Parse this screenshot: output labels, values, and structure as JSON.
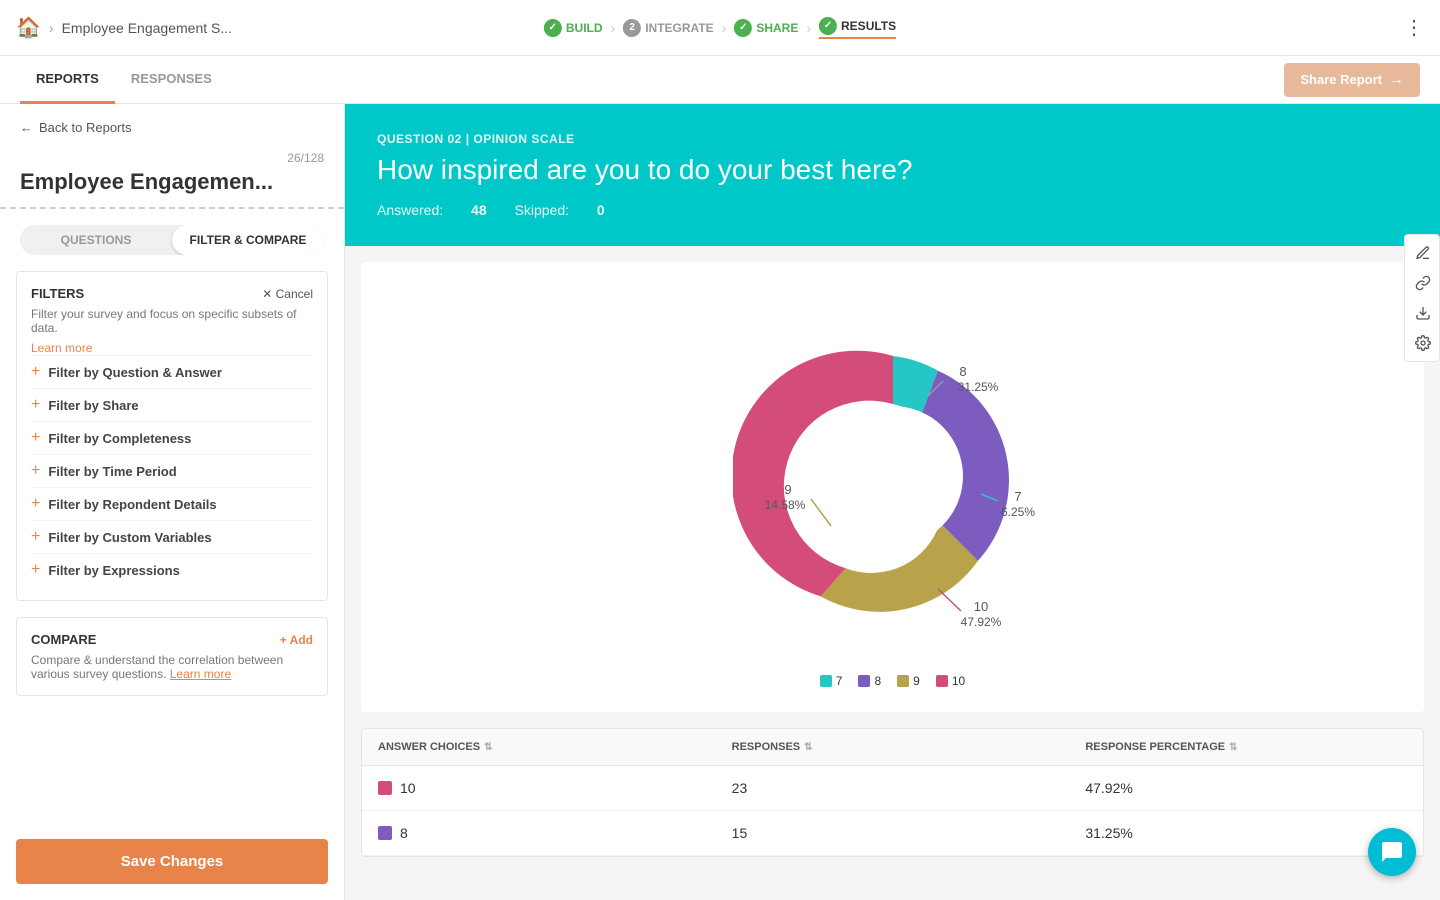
{
  "nav": {
    "home_icon": "🏠",
    "breadcrumb": "Employee Engagement S...",
    "steps": [
      {
        "id": "build",
        "label": "BUILD",
        "state": "done"
      },
      {
        "id": "integrate",
        "label": "INTEGRATE",
        "number": "2",
        "state": "number"
      },
      {
        "id": "share",
        "label": "SHARE",
        "state": "done"
      },
      {
        "id": "results",
        "label": "RESULTS",
        "state": "active"
      }
    ],
    "more_icon": "⋮"
  },
  "sub_nav": {
    "tabs": [
      {
        "id": "reports",
        "label": "REPORTS",
        "active": true
      },
      {
        "id": "responses",
        "label": "RESPONSES",
        "active": false
      }
    ],
    "share_btn": "Share Report"
  },
  "sidebar": {
    "back_label": "Back to Reports",
    "page_count": "26/128",
    "survey_title": "Employee Engagemen...",
    "tabs": [
      {
        "id": "questions",
        "label": "QUESTIONS"
      },
      {
        "id": "filter_compare",
        "label": "FILTER & COMPARE",
        "active": true
      }
    ],
    "filters": {
      "title": "FILTERS",
      "cancel_label": "✕ Cancel",
      "description": "Filter your survey and focus on specific subsets of data.",
      "learn_more": "Learn more",
      "items": [
        {
          "id": "question_answer",
          "label": "Filter by Question & Answer"
        },
        {
          "id": "share",
          "label": "Filter by Share"
        },
        {
          "id": "completeness",
          "label": "Filter by Completeness"
        },
        {
          "id": "time_period",
          "label": "Filter by Time Period"
        },
        {
          "id": "respondent_details",
          "label": "Filter by Repondent Details"
        },
        {
          "id": "custom_variables",
          "label": "Filter by Custom Variables"
        },
        {
          "id": "expressions",
          "label": "Filter by Expressions"
        }
      ]
    },
    "compare": {
      "title": "COMPARE",
      "add_label": "+ Add",
      "description": "Compare & understand the correlation between various survey questions.",
      "learn_more": "Learn more"
    },
    "save_btn": "Save Changes"
  },
  "question": {
    "meta": "QUESTION 02 | OPINION SCALE",
    "text": "How inspired are you to do your best here?",
    "answered_label": "Answered:",
    "answered_value": "48",
    "skipped_label": "Skipped:",
    "skipped_value": "0"
  },
  "chart": {
    "segments": [
      {
        "id": "7",
        "label": "7",
        "value": 3,
        "pct": "6.25%",
        "color": "#26c6c6",
        "start_angle": 0,
        "sweep": 22.5
      },
      {
        "id": "8",
        "label": "8",
        "value": 15,
        "pct": "31.25%",
        "color": "#7c5cbf",
        "start_angle": 22.5,
        "sweep": 112.5
      },
      {
        "id": "9",
        "label": "9",
        "value": 7,
        "pct": "14.58%",
        "color": "#b8a24a",
        "start_angle": 135,
        "sweep": 52.5
      },
      {
        "id": "10",
        "label": "10",
        "value": 23,
        "pct": "47.92%",
        "color": "#d44d7a",
        "start_angle": 187.5,
        "sweep": 172.5
      }
    ],
    "legend": [
      {
        "id": "7",
        "label": "7",
        "color": "#26c6c6"
      },
      {
        "id": "8",
        "label": "8",
        "color": "#7c5cbf"
      },
      {
        "id": "9",
        "label": "9",
        "color": "#b8a24a"
      },
      {
        "id": "10",
        "label": "10",
        "color": "#d44d7a"
      }
    ]
  },
  "table": {
    "headers": [
      {
        "id": "answer_choices",
        "label": "ANSWER CHOICES"
      },
      {
        "id": "responses",
        "label": "RESPONSES"
      },
      {
        "id": "response_percentage",
        "label": "RESPONSE PERCENTAGE"
      }
    ],
    "rows": [
      {
        "id": "10",
        "color": "#d44d7a",
        "label": "10",
        "responses": "23",
        "percentage": "47.92%"
      },
      {
        "id": "8",
        "color": "#7c5cbf",
        "label": "8",
        "responses": "15",
        "percentage": "31.25%"
      }
    ]
  },
  "toolbar": {
    "edit_icon": "✏",
    "link_icon": "🔗",
    "download_icon": "⬇",
    "settings_icon": "⚙"
  }
}
